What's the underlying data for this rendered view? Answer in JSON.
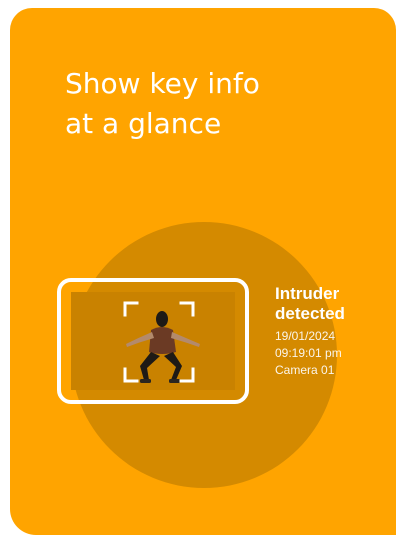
{
  "headline": {
    "line1": "Show key info",
    "line2": "at a glance"
  },
  "alert": {
    "title_line1": "Intruder",
    "title_line2": "detected",
    "date": "19/01/2024",
    "time": "09:19:01 pm",
    "camera": "Camera 01"
  },
  "colors": {
    "background": "#FFA400",
    "halo": "#D48A00",
    "frame": "#FFFFFF",
    "text": "#FFFFFF"
  },
  "icons": {
    "capture_frame": "camera-frame-icon",
    "focus_brackets": "focus-brackets-icon",
    "subject": "person-silhouette"
  }
}
